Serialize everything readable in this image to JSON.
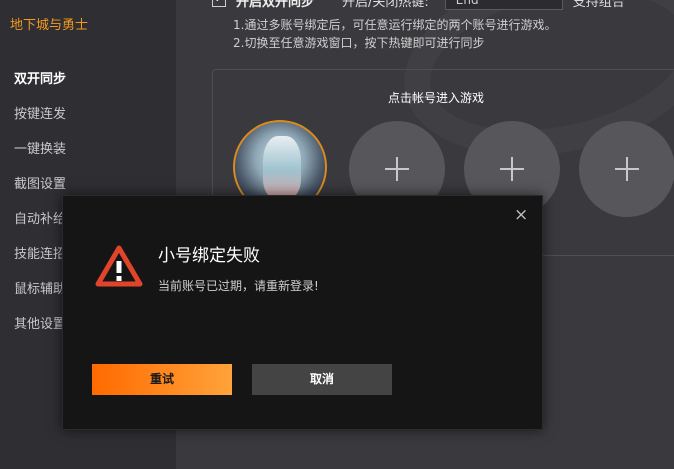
{
  "sidebar": {
    "app_title": "地下城与勇士",
    "items": [
      {
        "label": "双开同步",
        "active": true
      },
      {
        "label": "按键连发"
      },
      {
        "label": "一键换装"
      },
      {
        "label": "截图设置"
      },
      {
        "label": "自动补给"
      },
      {
        "label": "技能连招"
      },
      {
        "label": "鼠标辅助"
      },
      {
        "label": "其他设置"
      }
    ]
  },
  "main": {
    "sync_toggle_label": "开启双开同步",
    "sync_checked": true,
    "hotkey_label": "开启/关闭热键:",
    "hotkey_value": "End",
    "combo_label": "支持组合",
    "desc_line1": "1.通过多账号绑定后，可任意运行绑定的两个账号进行游戏。",
    "desc_line2": "2.切换至任意游戏窗口，按下热键即可进行同步",
    "panel_title": "点击帐号进入游戏"
  },
  "dialog": {
    "title": "小号绑定失败",
    "message": "当前账号已过期，请重新登录!",
    "retry_label": "重试",
    "cancel_label": "取消",
    "close_glyph": "×"
  },
  "colors": {
    "accent": "#f29a1f",
    "warning": "#e0452b",
    "button_gradient_start": "#ff6a00",
    "button_gradient_end": "#ffa33a"
  }
}
